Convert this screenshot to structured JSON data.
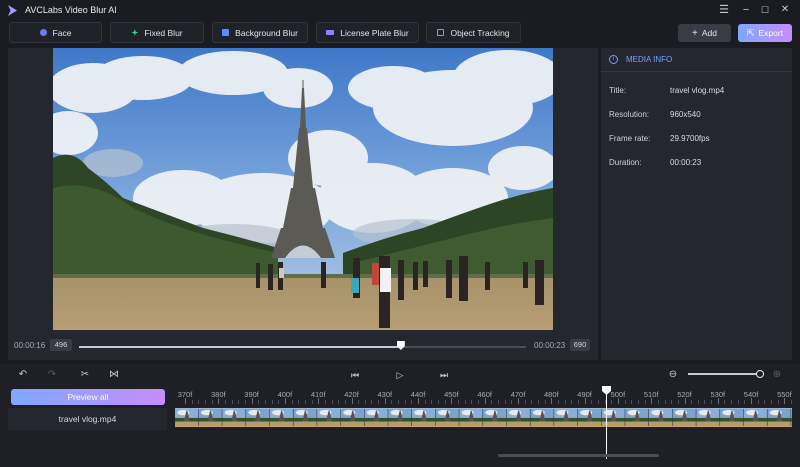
{
  "app": {
    "title": "AVCLabs Video Blur AI"
  },
  "window_controls": {
    "menu": "☰",
    "minimize": "−",
    "maximize": "☐",
    "close": "✕"
  },
  "toolbar": {
    "tools": [
      {
        "label": "Face",
        "icon": "face-icon",
        "color": "#6d7bff"
      },
      {
        "label": "Fixed Blur",
        "icon": "fixed-blur-icon",
        "color": "#35d39a"
      },
      {
        "label": "Background Blur",
        "icon": "background-blur-icon",
        "color": "#5b8cff"
      },
      {
        "label": "License Plate Blur",
        "icon": "license-plate-icon",
        "color": "#9b7bff"
      },
      {
        "label": "Object Tracking",
        "icon": "object-tracking-icon",
        "color": "#35d39a"
      }
    ],
    "add_label": "Add",
    "export_label": "Export"
  },
  "player": {
    "current_time": "00:00:16",
    "current_frame": "496",
    "total_time": "00:00:23",
    "total_frames": "690",
    "progress_percent": 72
  },
  "media_info": {
    "header": "MEDIA INFO",
    "rows": [
      {
        "label": "Title:",
        "value": "travel vlog.mp4"
      },
      {
        "label": "Resolution:",
        "value": "960x540"
      },
      {
        "label": "Frame rate:",
        "value": "29.9700fps"
      },
      {
        "label": "Duration:",
        "value": "00:00:23"
      }
    ]
  },
  "timeline": {
    "preview_all_label": "Preview all",
    "track_name": "travel vlog.mp4",
    "ruler_labels": [
      "370f",
      "380f",
      "390f",
      "400f",
      "410f",
      "420f",
      "430f",
      "440f",
      "450f",
      "460f",
      "470f",
      "480f",
      "490f",
      "500f",
      "510f",
      "520f",
      "530f",
      "540f",
      "550f"
    ],
    "zoom_level_percent": 95
  },
  "colors": {
    "accent_start": "#7fa8ff",
    "accent_end": "#c68dff",
    "info_blue": "#7aa2ff"
  }
}
